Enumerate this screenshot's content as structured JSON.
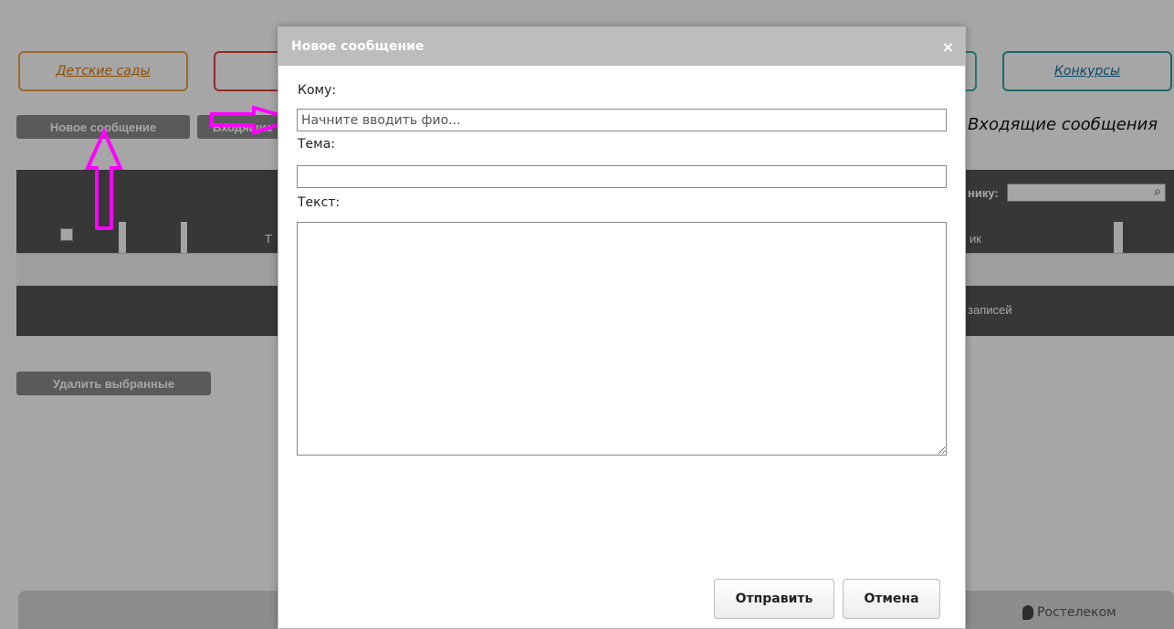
{
  "nav": {
    "sady": "Детские сады",
    "konkursy": "Конкурсы"
  },
  "toolbar": {
    "new_message": "Новое сообщение",
    "inbox_btn": "Входящие",
    "inbox_title": "Входящие сообщения",
    "delete_selected": "Удалить выбранные"
  },
  "table": {
    "search_label": "нику:",
    "col_t": "Т",
    "col_sender": "ик",
    "footer": "записей"
  },
  "footer": {
    "brand": "Ростелеком"
  },
  "dialog": {
    "title": "Новое сообщение",
    "close": "×",
    "to_label": "Кому:",
    "to_placeholder": "Начните вводить фио...",
    "subject_label": "Тема:",
    "subject_value": "",
    "text_label": "Текст:",
    "text_value": "",
    "send": "Отправить",
    "cancel": "Отмена"
  },
  "colors": {
    "annotation": "#ff00ff",
    "title_bar": "#bdbdbd"
  }
}
